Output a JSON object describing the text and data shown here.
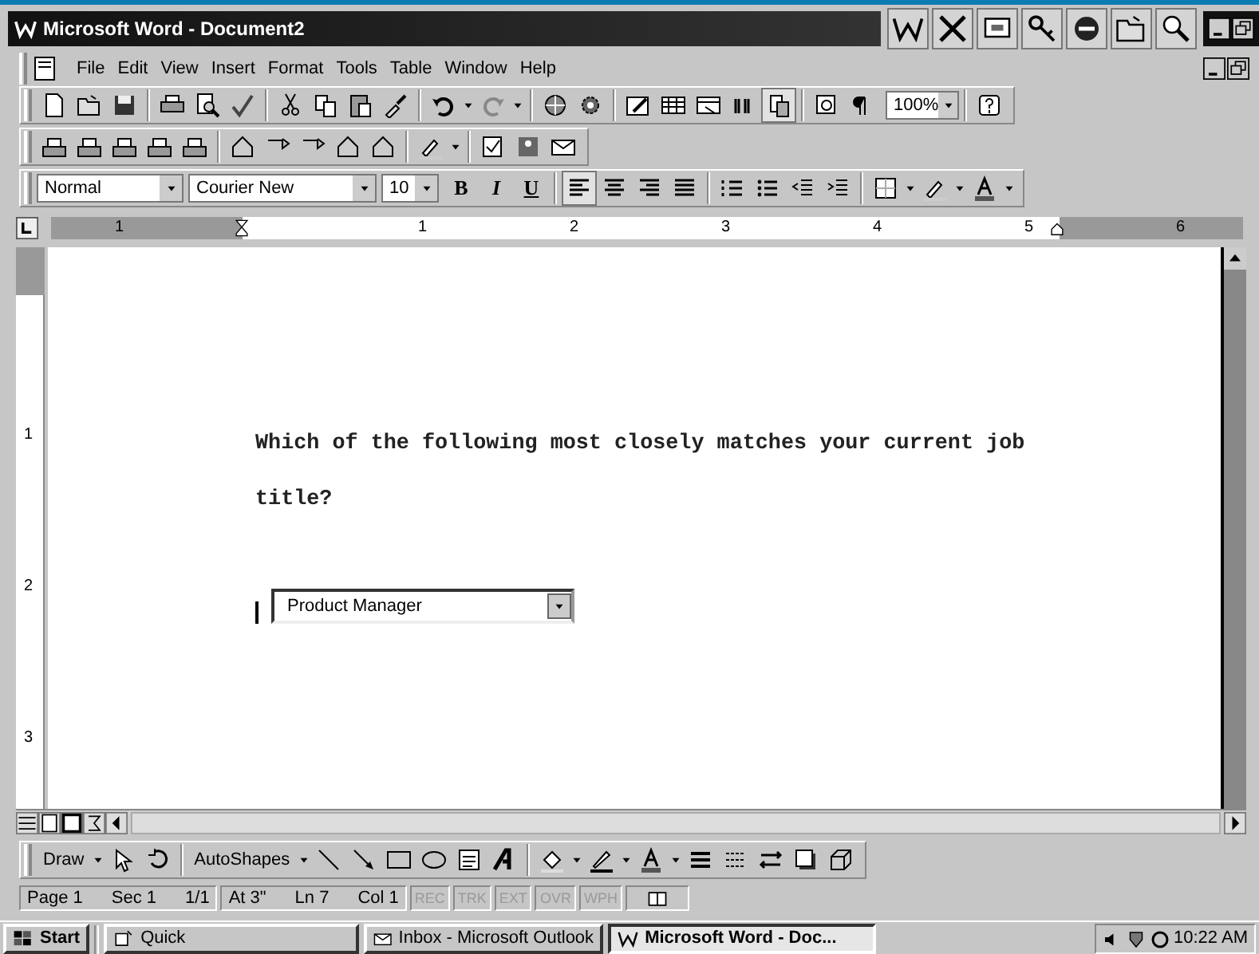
{
  "title_bar": {
    "title": "Microsoft Word - Document2"
  },
  "menu_bar": {
    "items": [
      "File",
      "Edit",
      "View",
      "Insert",
      "Format",
      "Tools",
      "Table",
      "Window",
      "Help"
    ]
  },
  "standard_toolbar": {
    "zoom": "100%"
  },
  "formatting_toolbar": {
    "style": "Normal",
    "font": "Courier New",
    "size": "10",
    "bold": "B",
    "italic": "I",
    "underline": "U"
  },
  "ruler": {
    "labels": [
      "1",
      "1",
      "2",
      "3",
      "4",
      "5",
      "6"
    ]
  },
  "vertical_ruler": {
    "labels": [
      "1",
      "2",
      "3"
    ]
  },
  "document": {
    "paragraph": "Which of the following most closely matches your current job title?",
    "dropdown": {
      "value": "Product Manager"
    }
  },
  "drawing_toolbar": {
    "draw": "Draw",
    "autoshapes": "AutoShapes"
  },
  "status_bar": {
    "fields": [
      "Page 1",
      "Sec 1",
      "1/1",
      "At 3\"",
      "Ln 7",
      "Col 1"
    ],
    "modes": [
      {
        "label": "REC",
        "on": false
      },
      {
        "label": "TRK",
        "on": false
      },
      {
        "label": "EXT",
        "on": false
      },
      {
        "label": "OVR",
        "on": false
      },
      {
        "label": "WPH",
        "on": false
      }
    ]
  },
  "taskbar": {
    "start": "Start",
    "buttons": [
      {
        "label": "Quick",
        "selected": false
      },
      {
        "label": "Inbox - Microsoft Outlook",
        "selected": false
      },
      {
        "label": "Microsoft Word - Doc...",
        "selected": true
      }
    ],
    "clock": "10:22 AM"
  }
}
